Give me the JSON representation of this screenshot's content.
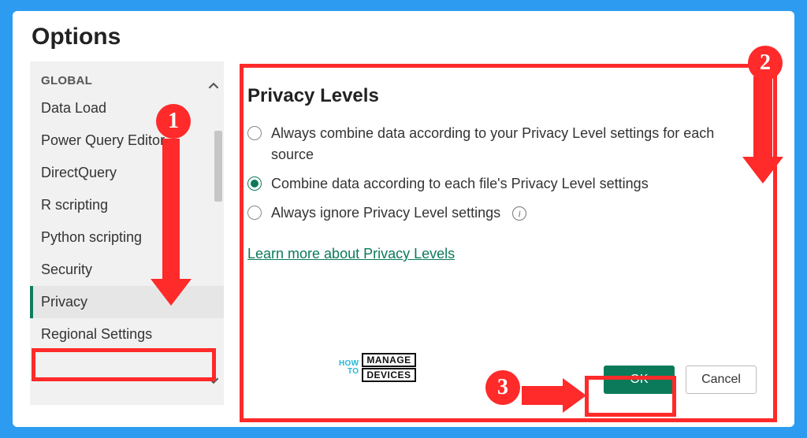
{
  "title": "Options",
  "sidebar": {
    "section": "GLOBAL",
    "items": [
      {
        "label": "Data Load"
      },
      {
        "label": "Power Query Editor"
      },
      {
        "label": "DirectQuery"
      },
      {
        "label": "R scripting"
      },
      {
        "label": "Python scripting"
      },
      {
        "label": "Security"
      },
      {
        "label": "Privacy",
        "selected": true
      },
      {
        "label": "Regional Settings"
      }
    ]
  },
  "panel": {
    "heading": "Privacy Levels",
    "options": [
      {
        "label": "Always combine data according to your Privacy Level settings for each source",
        "selected": false
      },
      {
        "label": "Combine data according to each file's Privacy Level settings",
        "selected": true
      },
      {
        "label": "Always ignore Privacy Level settings",
        "selected": false,
        "info": true
      }
    ],
    "link": "Learn more about Privacy Levels"
  },
  "buttons": {
    "ok": "OK",
    "cancel": "Cancel"
  },
  "annotations": {
    "badge1": "1",
    "badge2": "2",
    "badge3": "3"
  },
  "watermark": {
    "line1": "HOW",
    "line2": "TO",
    "block1": "MANAGE",
    "block2": "DEVICES"
  },
  "colors": {
    "accent": "#0b7a5a",
    "annotation": "#ff2a2a",
    "background": "#2d9cf0"
  }
}
